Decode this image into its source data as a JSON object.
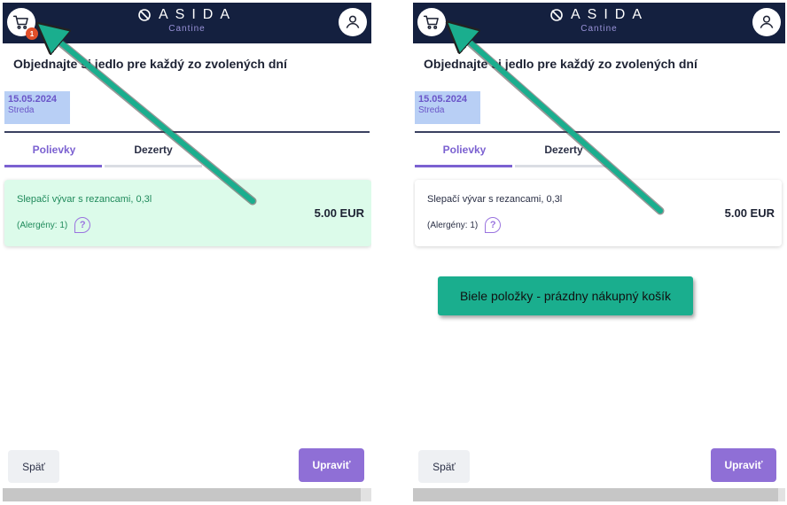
{
  "brand": {
    "name": "ASIDA",
    "subtitle": "Cantine"
  },
  "cart": {
    "badge_count": "1"
  },
  "page": {
    "title": "Objednajte si jedlo pre každý zo zvolených dní"
  },
  "date": {
    "value": "15.05.2024",
    "weekday": "Streda"
  },
  "tabs": [
    {
      "label": "Polievky",
      "active": true
    },
    {
      "label": "Dezerty",
      "active": false
    }
  ],
  "item": {
    "name": "Slepačí vývar s rezancami, 0,3l",
    "allergens": "(Alergény: 1)",
    "price": "5.00 EUR"
  },
  "buttons": {
    "back": "Späť",
    "edit": "Upraviť"
  },
  "annotation": {
    "callout_text": "Biele položky - prázdny nákupný košík"
  },
  "colors": {
    "header_bg": "#14203f",
    "accent": "#8f6fd6",
    "selected_item_bg": "#dcfbea",
    "selected_item_text": "#1f8a5b",
    "annotation": "#1aae8e",
    "badge": "#e14f2a"
  },
  "icons": {
    "cart": "cart-icon",
    "user": "user-icon",
    "help": "question-icon",
    "logo": "asida-logo-icon"
  }
}
